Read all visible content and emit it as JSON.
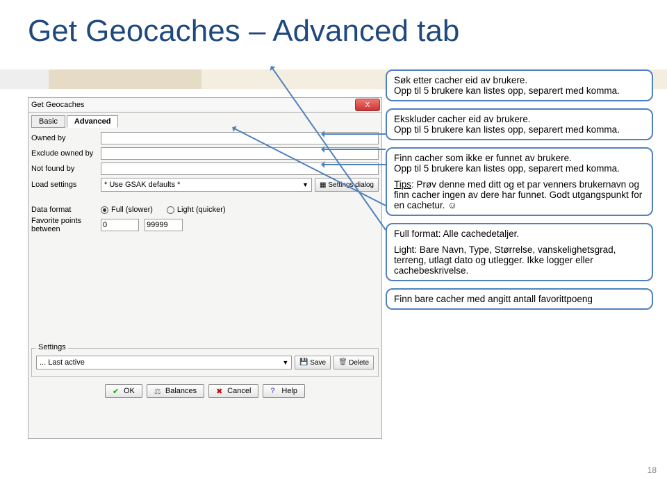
{
  "title": "Get Geocaches – Advanced tab",
  "page_number": "18",
  "dialog": {
    "title": "Get Geocaches",
    "close_x": "X",
    "tabs": {
      "basic": "Basic",
      "advanced": "Advanced"
    },
    "labels": {
      "owned_by": "Owned by",
      "exclude_owned": "Exclude owned by",
      "not_found_by": "Not found by",
      "load_settings": "Load settings",
      "data_format": "Data format",
      "fav_between": "Favorite points between"
    },
    "load_value": "* Use GSAK defaults *",
    "settings_dialog_btn": "Settings dialog",
    "format_full": "Full (slower)",
    "format_light": "Light (quicker)",
    "fav_min": "0",
    "fav_max": "99999",
    "settings_group": "Settings",
    "settings_value": "... Last active",
    "save_btn": "Save",
    "delete_btn": "Delete",
    "ok_btn": "OK",
    "balances_btn": "Balances",
    "cancel_btn": "Cancel",
    "help_btn": "Help"
  },
  "callouts": {
    "c1": "Søk etter cacher eid av brukere.\nOpp til 5 brukere kan listes opp, separert med komma.",
    "c2": "Ekskluder cacher eid av brukere.\nOpp til 5 brukere kan listes opp, separert med komma.",
    "c3a": "Finn cacher som ikke er funnet av brukere.\nOpp til 5 brukere kan listes opp, separert med komma.",
    "c3_tips_label": "Tips",
    "c3b": ": Prøv denne med ditt og et par venners brukernavn og finn cacher ingen av dere har funnet. Godt utgangspunkt for en cachetur. ☺",
    "c4a": "Full format: Alle cachedetaljer.",
    "c4b": "Light: Bare Navn, Type, Størrelse, vanskelighetsgrad, terreng, utlagt dato og utlegger. Ikke logger eller cachebeskrivelse.",
    "c5": "Finn bare cacher med angitt antall favorittpoeng"
  }
}
